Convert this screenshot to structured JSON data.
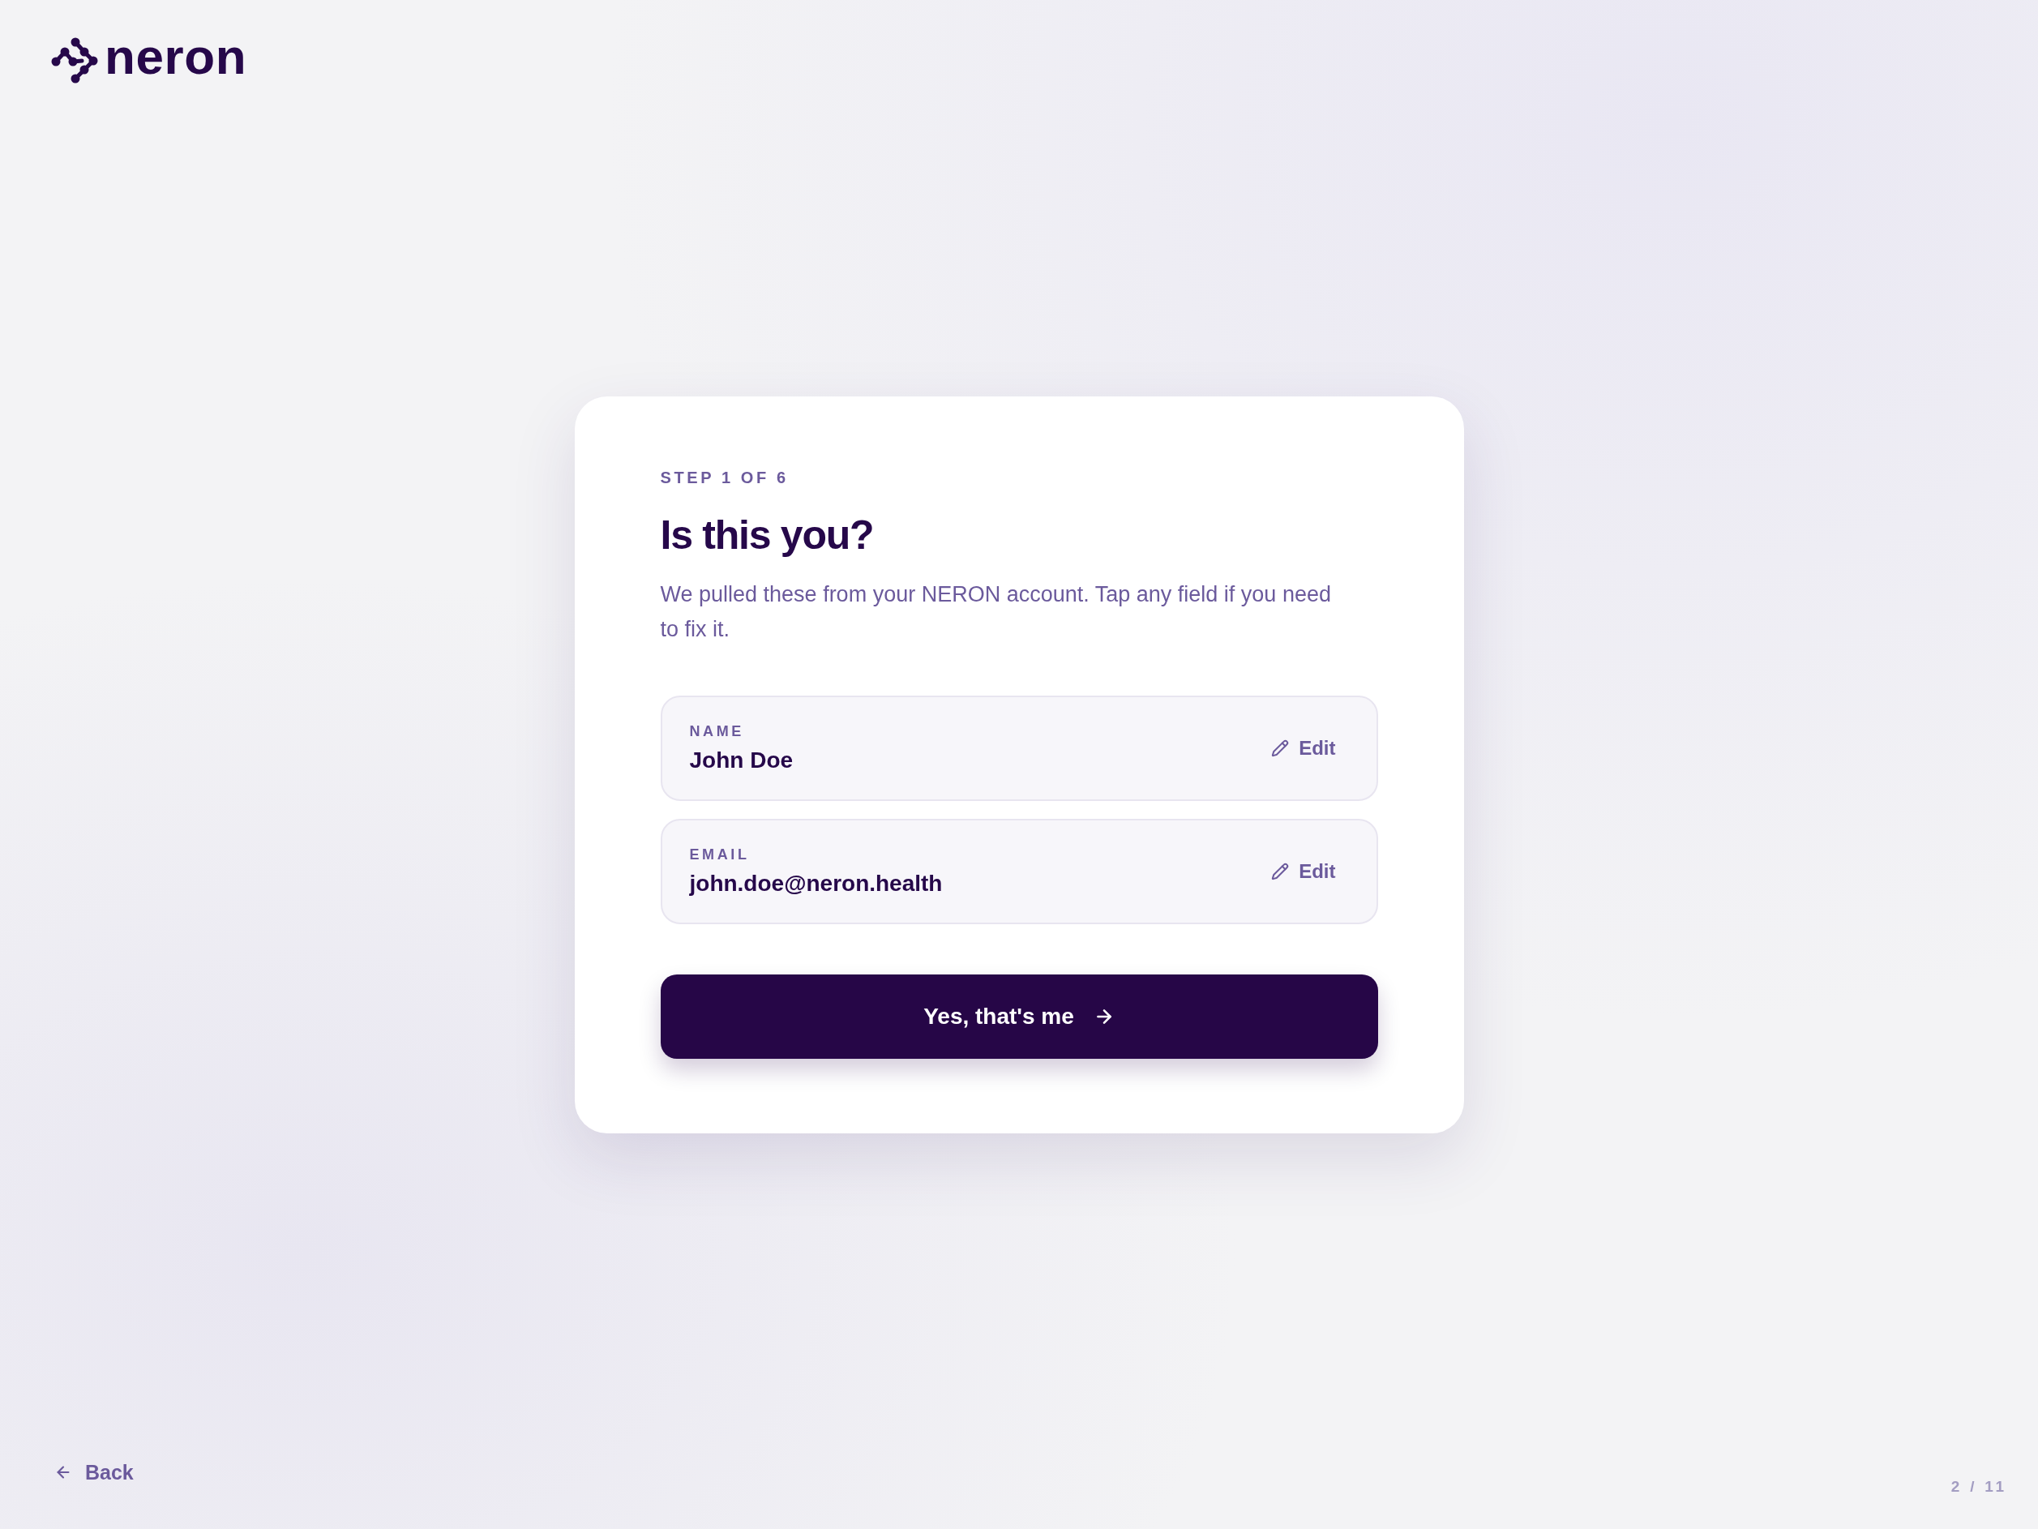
{
  "logo": {
    "wordmark": "neron"
  },
  "card": {
    "step": "STEP 1 OF 6",
    "title": "Is this you?",
    "description": "We pulled these from your NERON account. Tap any field if you need to fix it.",
    "fields": [
      {
        "label": "NAME",
        "value": "John Doe",
        "action": "Edit"
      },
      {
        "label": "EMAIL",
        "value": "john.doe@neron.health",
        "action": "Edit"
      }
    ],
    "confirm_button": {
      "label": "Yes, that's me"
    }
  },
  "back_link": {
    "label": "Back"
  },
  "page_counter": "2 / 11"
}
